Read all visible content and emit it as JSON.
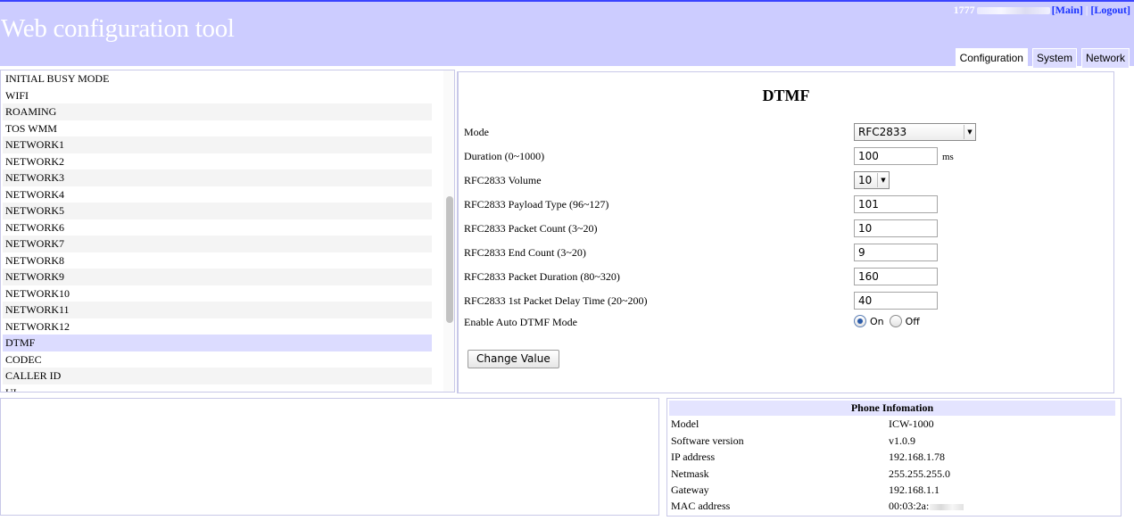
{
  "header": {
    "title": "Web configuration tool",
    "user_id": "1777",
    "main_link": "[Main]",
    "separator": "|",
    "logout_link": "[Logout]",
    "tabs": [
      {
        "label": "Configuration",
        "active": true
      },
      {
        "label": "System",
        "active": false
      },
      {
        "label": "Network",
        "active": false
      }
    ]
  },
  "sidebar": {
    "items": [
      {
        "label": "INITIAL BUSY MODE"
      },
      {
        "label": "WIFI"
      },
      {
        "label": "ROAMING"
      },
      {
        "label": "TOS WMM"
      },
      {
        "label": "NETWORK1"
      },
      {
        "label": "NETWORK2"
      },
      {
        "label": "NETWORK3"
      },
      {
        "label": "NETWORK4"
      },
      {
        "label": "NETWORK5"
      },
      {
        "label": "NETWORK6"
      },
      {
        "label": "NETWORK7"
      },
      {
        "label": "NETWORK8"
      },
      {
        "label": "NETWORK9"
      },
      {
        "label": "NETWORK10"
      },
      {
        "label": "NETWORK11"
      },
      {
        "label": "NETWORK12"
      },
      {
        "label": "DTMF",
        "selected": true
      },
      {
        "label": "CODEC"
      },
      {
        "label": "CALLER ID"
      },
      {
        "label": "UI"
      }
    ]
  },
  "config": {
    "title": "DTMF",
    "mode": {
      "label": "Mode",
      "value": "RFC2833"
    },
    "duration": {
      "label": "Duration (0~1000)",
      "value": "100",
      "unit": "ms"
    },
    "volume": {
      "label": "RFC2833 Volume",
      "value": "10"
    },
    "payload_type": {
      "label": "RFC2833 Payload Type (96~127)",
      "value": "101"
    },
    "packet_count": {
      "label": "RFC2833 Packet Count (3~20)",
      "value": "10"
    },
    "end_count": {
      "label": "RFC2833 End Count (3~20)",
      "value": "9"
    },
    "packet_duration": {
      "label": "RFC2833 Packet Duration (80~320)",
      "value": "160"
    },
    "first_delay": {
      "label": "RFC2833 1st Packet Delay Time (20~200)",
      "value": "40"
    },
    "auto_dtmf": {
      "label": "Enable Auto DTMF Mode",
      "on_label": "On",
      "off_label": "Off",
      "selected": "On"
    },
    "change_button": "Change Value"
  },
  "phone_info": {
    "title": "Phone Infomation",
    "rows": [
      {
        "key": "Model",
        "value": "ICW-1000"
      },
      {
        "key": "Software version",
        "value": "v1.0.9"
      },
      {
        "key": "IP address",
        "value": "192.168.1.78"
      },
      {
        "key": "Netmask",
        "value": "255.255.255.0"
      },
      {
        "key": "Gateway",
        "value": "192.168.1.1"
      },
      {
        "key": "MAC address",
        "value": "00:03:2a:"
      }
    ]
  }
}
